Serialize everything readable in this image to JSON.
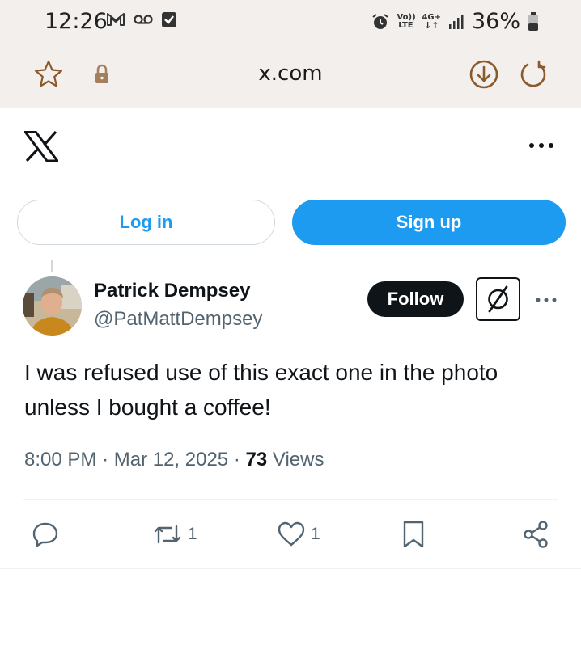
{
  "status_bar": {
    "time": "12:26",
    "network_top": "Vo)) LTE",
    "network_4g": "4G+",
    "battery": "36%"
  },
  "browser": {
    "url": "x.com"
  },
  "auth": {
    "login_label": "Log in",
    "signup_label": "Sign up"
  },
  "tweet": {
    "author_name": "Patrick Dempsey",
    "author_handle": "@PatMattDempsey",
    "follow_label": "Follow",
    "text": "I was refused use of this exact one in the photo unless I bought a coffee!",
    "time": "8:00 PM",
    "date": "Mar 12, 2025",
    "views_count": "73",
    "views_label": "Views",
    "retweet_count": "1",
    "like_count": "1"
  },
  "colors": {
    "accent": "#1d9bf0",
    "text": "#0f1419",
    "muted": "#536471",
    "chrome": "#f3efec",
    "browser_icon": "#8a5a2b"
  }
}
